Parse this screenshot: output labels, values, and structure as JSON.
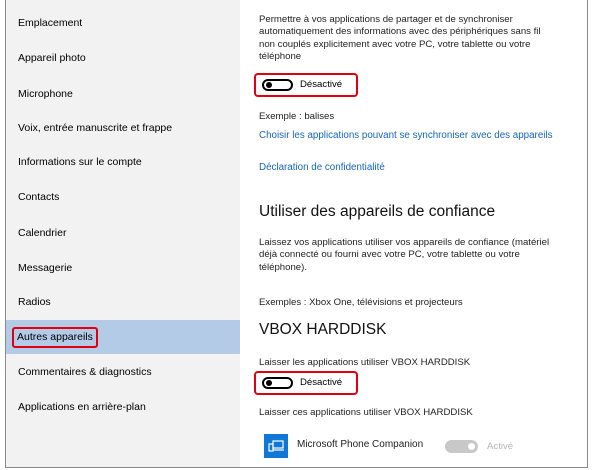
{
  "sidebar": {
    "items": [
      {
        "label": "Emplacement"
      },
      {
        "label": "Appareil photo"
      },
      {
        "label": "Microphone"
      },
      {
        "label": "Voix, entrée manuscrite et frappe"
      },
      {
        "label": "Informations sur le compte"
      },
      {
        "label": "Contacts"
      },
      {
        "label": "Calendrier"
      },
      {
        "label": "Messagerie"
      },
      {
        "label": "Radios"
      },
      {
        "label": "Autres appareils",
        "selected": true
      },
      {
        "label": "Commentaires & diagnostics"
      },
      {
        "label": "Applications en arrière-plan"
      }
    ]
  },
  "sync": {
    "description_lines": [
      "Permettre à vos applications de partager et de synchroniser",
      "automatiquement des informations avec des périphériques sans fil",
      "non couplés explicitement avec votre PC, votre tablette ou votre",
      "téléphone"
    ],
    "toggle_state": "Désactivé",
    "example": "Exemple : balises",
    "choose_link": "Choisir les applications pouvant se synchroniser avec des appareils",
    "privacy_link": "Déclaration de confidentialité"
  },
  "trusted": {
    "title": "Utiliser des appareils de confiance",
    "description_lines": [
      "Laissez vos applications utiliser vos appareils de confiance (matériel",
      "déjà connecté ou fourni avec votre PC, votre tablette ou votre",
      "téléphone)."
    ],
    "examples": "Exemples : Xbox One, télévisions et projecteurs"
  },
  "device": {
    "title": "VBOX HARDDISK",
    "allow_label": "Laisser les applications utiliser VBOX HARDDISK",
    "toggle_state": "Désactivé",
    "list_label": "Laisser ces applications utiliser VBOX HARDDISK",
    "apps": [
      {
        "name": "Microsoft Phone Companion",
        "state": "Activé"
      }
    ]
  },
  "colors": {
    "highlight": "#e0000f",
    "selection": "#b3cbe6",
    "link": "#1565c0",
    "accent": "#0f78d7"
  }
}
